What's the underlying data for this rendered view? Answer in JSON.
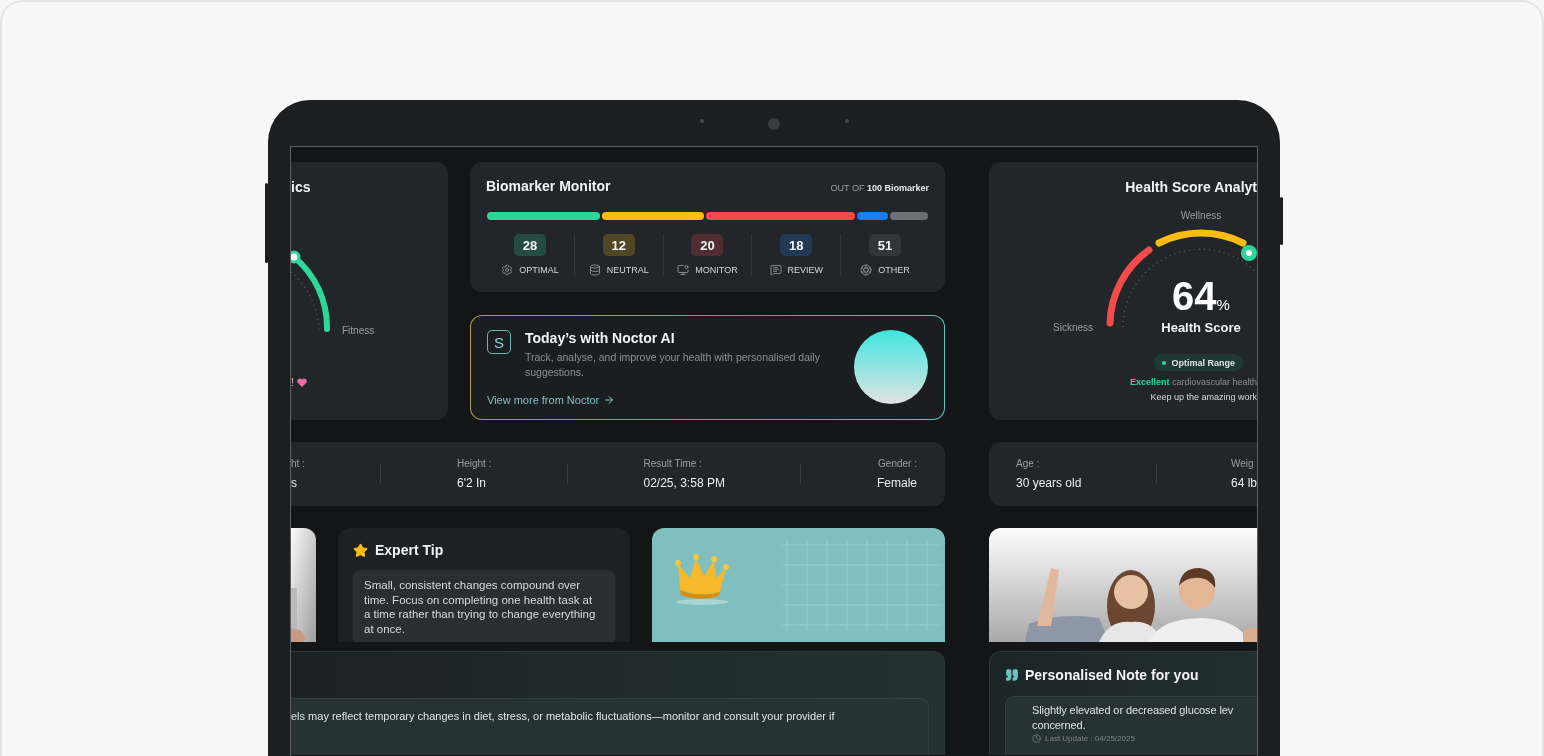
{
  "left_card": {
    "title": "ics",
    "gauge_label": "Fitness",
    "note": "!"
  },
  "biomarker": {
    "title": "Biomarker Monitor",
    "total_prefix": "OUT OF",
    "total": "100 Biomarker",
    "categories": [
      {
        "count": "28",
        "label": "OPTIMAL",
        "color": "#2fd69a"
      },
      {
        "count": "12",
        "label": "NEUTRAL",
        "color": "#fbbd14"
      },
      {
        "count": "20",
        "label": "MONITOR",
        "color": "#f34a4a"
      },
      {
        "count": "18",
        "label": "REVIEW",
        "color": "#1a7ff0"
      },
      {
        "count": "51",
        "label": "OTHER",
        "color": "#6c6f73"
      }
    ]
  },
  "ai_card": {
    "badge": "S",
    "title": "Today’s with Noctor AI",
    "text": "Track, analyse, and improve your health with personalised daily suggestions.",
    "link": "View more from Noctor"
  },
  "health_score": {
    "title": "Health Score Analyt",
    "top_label": "Wellness",
    "left_label": "Sickness",
    "score": "64",
    "unit": "%",
    "score_label": "Health Score",
    "status": "Optimal Range",
    "highlight": "Excellent",
    "message": "cardiovascular health",
    "footer": "Keep up the amazing work"
  },
  "profile_stats": [
    {
      "label": "ht :",
      "value": "s"
    },
    {
      "label": "Height :",
      "value": "6'2 In"
    },
    {
      "label": "Result Time :",
      "value": "02/25, 3:58 PM"
    },
    {
      "label": "Gender :",
      "value": "Female"
    }
  ],
  "body_stats": [
    {
      "label": "Age :",
      "value": "30 years old"
    },
    {
      "label": "Weig",
      "value": "64 lb"
    }
  ],
  "expert_tip": {
    "title": "Expert Tip",
    "text": "Small, consistent changes compound over time. Focus on completing one health task at a time rather than trying to change everything at once."
  },
  "insight": {
    "text": "els may reflect temporary changes in diet, stress, or metabolic fluctuations—monitor and consult your provider if"
  },
  "note": {
    "title": "Personalised Note for you",
    "lines": [
      "Slightly elevated or decreased glucose lev",
      "concerned."
    ],
    "updated": "Last Update : 04/25/2025"
  }
}
